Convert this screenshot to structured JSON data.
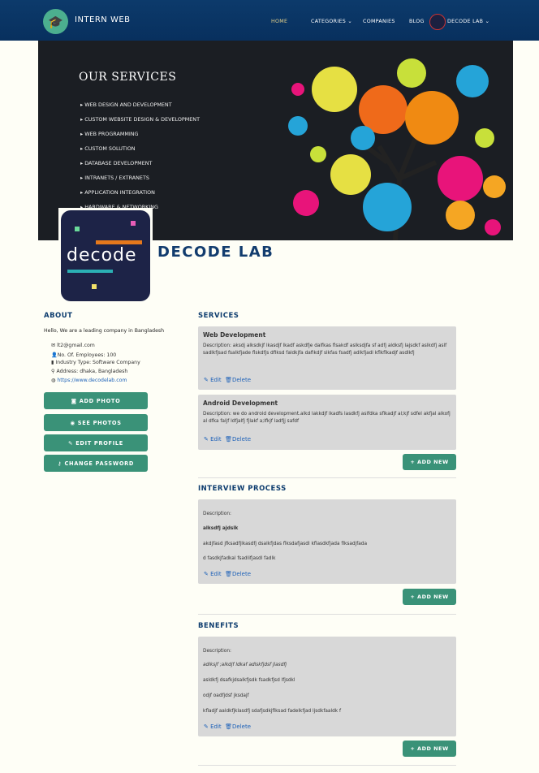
{
  "navbar": {
    "brand": "INTERN WEB",
    "items": [
      {
        "label": "HOME"
      },
      {
        "label": "CATEGORIES ⌄"
      },
      {
        "label": "COMPANIES"
      },
      {
        "label": "BLOG"
      },
      {
        "label": "DECODE LAB ⌄"
      }
    ]
  },
  "banner": {
    "title": "OUR SERVICES",
    "list": [
      "WEB DESIGN AND DEVELOPMENT",
      "CUSTOM WEBSITE DESIGN & DEVELOPMENT",
      "WEB PROGRAMMING",
      "CUSTOM SOLUTION",
      "DATABASE DEVELOPMENT",
      "INTRANETS / EXTRANETS",
      "APPLICATION INTEGRATION",
      "HARDWARE & NETWORKING"
    ]
  },
  "company": {
    "logo_text": "decode",
    "name": "DECODE LAB"
  },
  "about": {
    "heading": "ABOUT",
    "text": "Hello, We are a leading company in Bangladesh",
    "email": "lt2@gmail.com",
    "employees": "No. Of. Employees: 100",
    "industry": "Industry Type: Software Company",
    "address": "Address: dhaka, Bangladesh",
    "website": "https://www.decodelab.com"
  },
  "buttons": {
    "add_photo": "ADD PHOTO",
    "see_photos": "SEE PHOTOS",
    "edit_profile": "EDIT PROFILE",
    "change_password": "CHANGE PASSWORD",
    "add_new": "+ ADD NEW",
    "edit": "Edit",
    "delete": "Delete"
  },
  "services": {
    "heading": "SERVICES",
    "items": [
      {
        "title": "Web Development",
        "description": "Description: aksdj alksdkjf lkasdjf lkadf askdfje dalfkas flsakdf aslksdjfa sf adfj aldksfj lajsdkf aslkdfj aslf sadlkfjsad fsalkfjade flskdfjs dfiksd faldkjfa dafikdjf slkfas fsadfj adlkfjadl kflkflkadjf asdlkfj"
      },
      {
        "title": "Android Development",
        "description": "Description: we do android development.alkd lakkdjf lkadfs lasdkfj aslfdka sflkadjf al;kjf sdfel akfjal alkofj al dfka faljf ldfjalfj fjlakf a;lfkjf ladfjj safdf"
      }
    ]
  },
  "interview": {
    "heading": "INTERVIEW PROCESS",
    "label": "Description:",
    "lines": [
      "alksdfj ajdsik",
      "akdjfasd jfksadfjlkasdfj dsalkfjdas flksdafjasdl kflasdkfjada flksadjfada",
      "d fasdkjfadkal fsadlifjasdl fadlk"
    ]
  },
  "benefits": {
    "heading": "BENEFITS",
    "label": "Description:",
    "lines": [
      "adlksjf ;alkdjf ldkaf adlskfjdsf jlasdfj",
      " asldkfj dsafkjdsalkfjsdk fsadkfjsd lfjsdkl",
      "odjf oadfjdsf jksdajf",
      "kfladjf aaldkfjklasdfj sdafjsdkjflksad fadelkfjad ljsdkfaaldk f"
    ]
  }
}
